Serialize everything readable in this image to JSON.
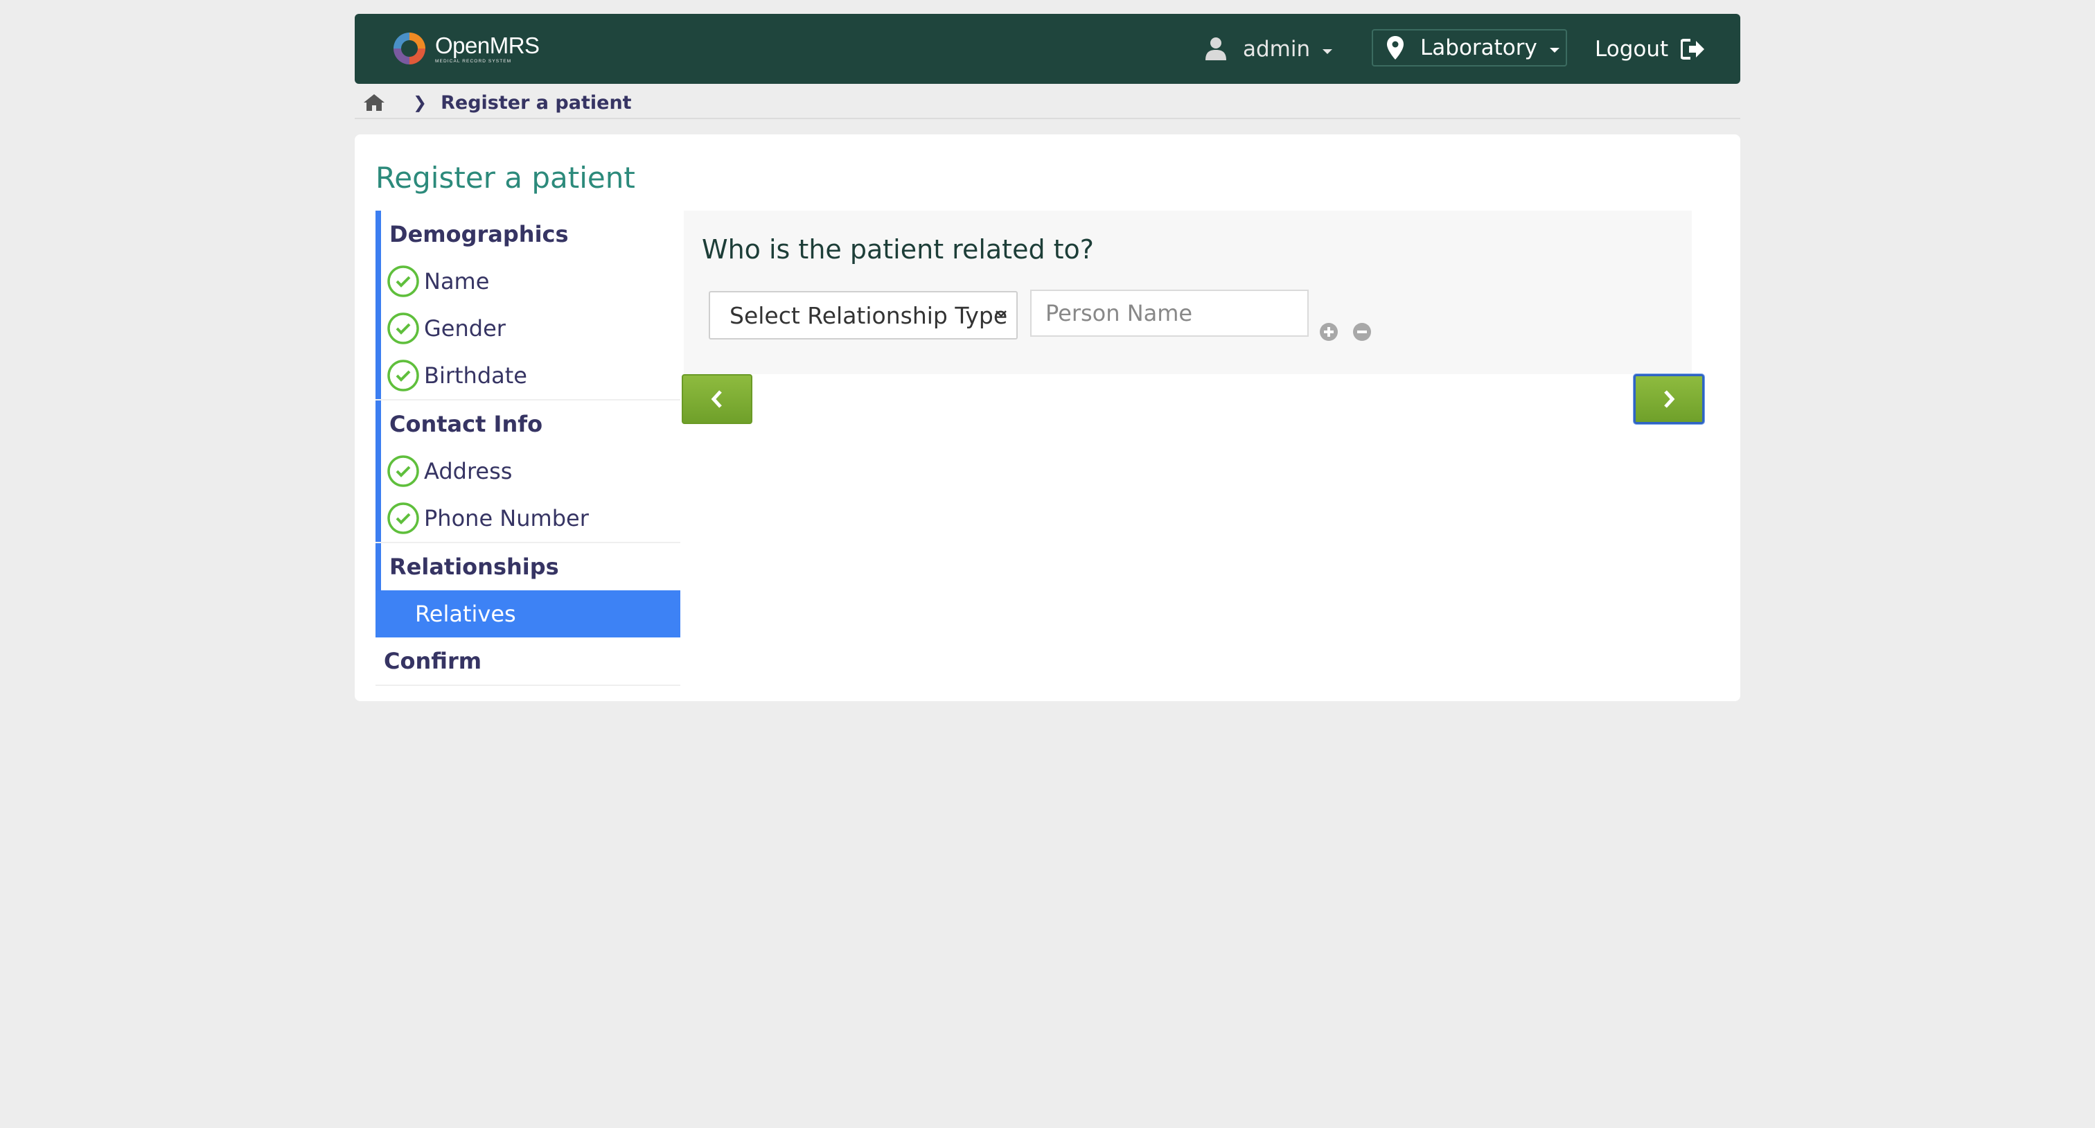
{
  "header": {
    "logo": {
      "name": "OpenMRS",
      "tagline": "MEDICAL RECORD SYSTEM"
    },
    "user": {
      "label": "admin",
      "icon": "user-icon"
    },
    "location": {
      "label": "Laboratory",
      "icon": "map-marker-icon"
    },
    "logout": {
      "label": "Logout",
      "icon": "logout-icon"
    },
    "background_color": "#1f453d"
  },
  "breadcrumb": {
    "home_icon": "home-icon",
    "current": "Register a patient"
  },
  "page": {
    "title": "Register a patient"
  },
  "nav": {
    "sections": [
      {
        "label": "Demographics",
        "items": [
          {
            "label": "Name",
            "status": "done"
          },
          {
            "label": "Gender",
            "status": "done"
          },
          {
            "label": "Birthdate",
            "status": "done"
          }
        ]
      },
      {
        "label": "Contact Info",
        "items": [
          {
            "label": "Address",
            "status": "done"
          },
          {
            "label": "Phone Number",
            "status": "done"
          }
        ]
      },
      {
        "label": "Relationships",
        "items": [
          {
            "label": "Relatives",
            "status": "active"
          }
        ]
      },
      {
        "label": "Confirm",
        "items": []
      }
    ]
  },
  "form": {
    "question": "Who is the patient related to?",
    "relationship_select": {
      "selected": "Select Relationship Type"
    },
    "person_name": {
      "value": "",
      "placeholder": "Person Name"
    },
    "add_icon": "plus-circle-icon",
    "remove_icon": "minus-circle-icon"
  },
  "buttons": {
    "prev_icon": "chevron-left-icon",
    "next_icon": "chevron-right-icon"
  },
  "colors": {
    "accent_title": "#2c8a7b",
    "active_nav": "#3d82f5",
    "check": "#5fbf3c",
    "button_green": "#7fae34"
  }
}
